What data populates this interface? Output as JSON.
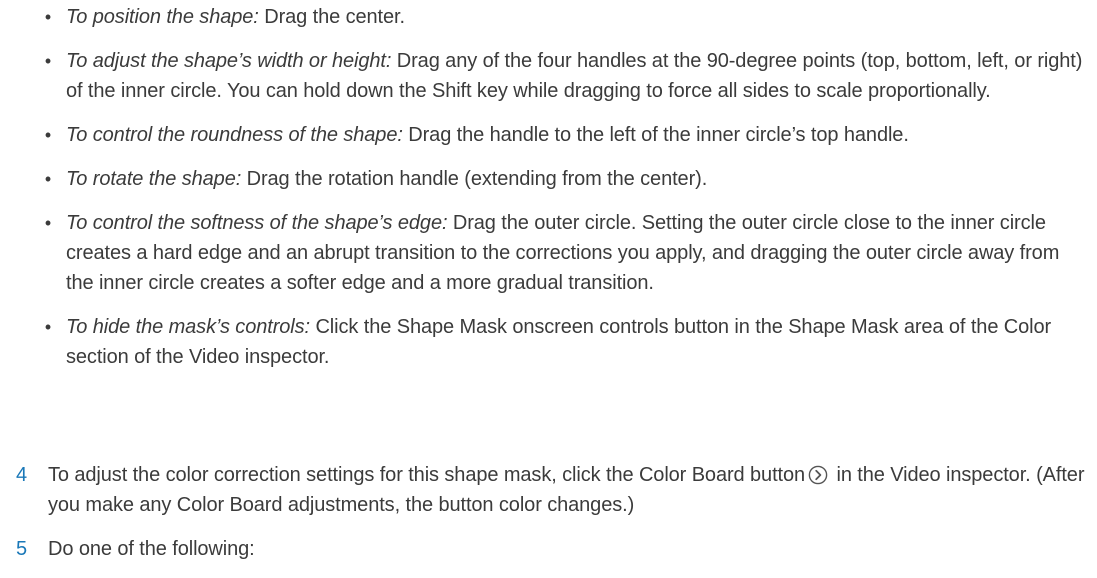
{
  "bullets": [
    {
      "lead": "To position the shape:",
      "text": " Drag the center."
    },
    {
      "lead": "To adjust the shape’s width or height:",
      "text": " Drag any of the four handles at the 90-degree points (top, bottom, left, or right) of the inner circle. You can hold down the Shift key while dragging to force all sides to scale proportionally."
    },
    {
      "lead": "To control the roundness of the shape:",
      "text": " Drag the handle to the left of the inner circle’s top handle."
    },
    {
      "lead": "To rotate the shape:",
      "text": " Drag the rotation handle (extending from the center)."
    },
    {
      "lead": "To control the softness of the shape’s edge:",
      "text": " Drag the outer circle. Setting the outer circle close to the inner circle creates a hard edge and an abrupt transition to the corrections you apply, and dragging the outer circle away from the inner circle creates a softer edge and a more gradual transition."
    },
    {
      "lead": "To hide the mask’s controls:",
      "text": " Click the Shape Mask onscreen controls button in the Shape Mask area of the Color section of the Video inspector."
    }
  ],
  "bullet_glyph": "•",
  "steps": [
    {
      "number": "4",
      "text_before": "To adjust the color correction settings for this shape mask, click the Color Board button",
      "icon": "chevron-right-circle-icon",
      "text_after": " in the Video inspector. (After you make any Color Board adjustments, the button color changes.)"
    },
    {
      "number": "5",
      "text": "Do one of the following:"
    }
  ],
  "colors": {
    "body_text": "#3b3b3b",
    "step_number": "#1a78b8"
  }
}
